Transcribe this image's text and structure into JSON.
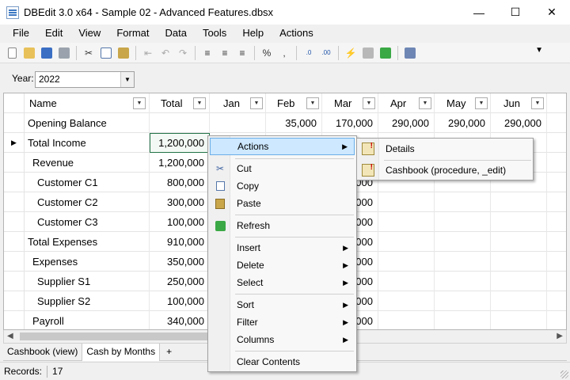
{
  "window": {
    "title": "DBEdit 3.0 x64 - Sample 02 - Advanced Features.dbsx",
    "minimize_glyph": "—",
    "maximize_glyph": "☐",
    "close_glyph": "✕"
  },
  "menu": [
    "File",
    "Edit",
    "View",
    "Format",
    "Data",
    "Tools",
    "Help",
    "Actions"
  ],
  "year": {
    "label": "Year:",
    "value": "2022"
  },
  "grid": {
    "columns": [
      "Name",
      "Total",
      "Jan",
      "Feb",
      "Mar",
      "Apr",
      "May",
      "Jun"
    ],
    "rows": [
      {
        "name": "Opening Balance",
        "total": "",
        "jan": "",
        "feb": "35,000",
        "mar": "170,000",
        "apr": "290,000",
        "may": "290,000",
        "jun": "290,000"
      },
      {
        "name": "Total Income",
        "total": "1,200,000",
        "jan": "",
        "feb": "",
        "mar": "",
        "apr": "",
        "may": "",
        "jun": ""
      },
      {
        "name": "Revenue",
        "total": "1,200,000",
        "jan": "",
        "feb": "",
        "mar": "",
        "apr": "",
        "may": "",
        "jun": ""
      },
      {
        "name": "Customer C1",
        "total": "800,000",
        "jan": "",
        "feb": "",
        "mar": "000",
        "apr": "",
        "may": "",
        "jun": ""
      },
      {
        "name": "Customer C2",
        "total": "300,000",
        "jan": "",
        "feb": "",
        "mar": "000",
        "apr": "",
        "may": "",
        "jun": ""
      },
      {
        "name": "Customer C3",
        "total": "100,000",
        "jan": "",
        "feb": "",
        "mar": "000",
        "apr": "",
        "may": "",
        "jun": ""
      },
      {
        "name": "Total Expenses",
        "total": "910,000",
        "jan": "",
        "feb": "",
        "mar": "000",
        "apr": "",
        "may": "",
        "jun": ""
      },
      {
        "name": "Expenses",
        "total": "350,000",
        "jan": "",
        "feb": "",
        "mar": "000",
        "apr": "",
        "may": "",
        "jun": ""
      },
      {
        "name": "Supplier S1",
        "total": "250,000",
        "jan": "",
        "feb": "",
        "mar": "000",
        "apr": "",
        "may": "",
        "jun": ""
      },
      {
        "name": "Supplier S2",
        "total": "100,000",
        "jan": "",
        "feb": "",
        "mar": "000",
        "apr": "",
        "may": "",
        "jun": ""
      },
      {
        "name": "Payroll",
        "total": "340,000",
        "jan": "",
        "feb": "",
        "mar": "000",
        "apr": "",
        "may": "",
        "jun": ""
      }
    ]
  },
  "tabs": [
    "Cashbook (view)",
    "Cash by Months",
    "+"
  ],
  "status": {
    "records_label": "Records:",
    "records_value": "17"
  },
  "context_menu": {
    "actions": "Actions",
    "cut": "Cut",
    "copy": "Copy",
    "paste": "Paste",
    "refresh": "Refresh",
    "insert": "Insert",
    "delete": "Delete",
    "select": "Select",
    "sort": "Sort",
    "filter": "Filter",
    "columns": "Columns",
    "clear_contents": "Clear Contents"
  },
  "submenu": {
    "details": "Details",
    "cashbook": "Cashbook (procedure, _edit)"
  },
  "colors": {
    "highlight": "#cde8ff",
    "selected_border": "#217346"
  }
}
